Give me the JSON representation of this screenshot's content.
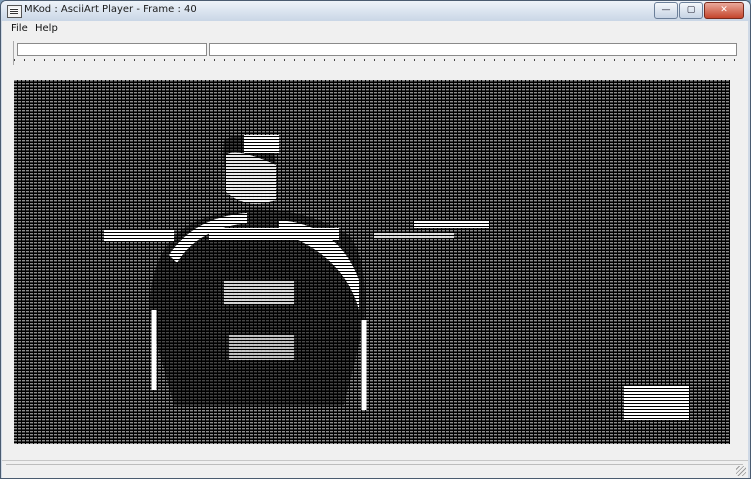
{
  "window": {
    "title": "MKod : AsciiArt Player - Frame : 40",
    "controls": [
      "minimize-icon",
      "maximize-icon",
      "close-icon"
    ]
  },
  "menu": {
    "items": [
      {
        "label": "File"
      },
      {
        "label": "Help"
      }
    ]
  },
  "toolbar": {
    "left_field_value": "",
    "right_field_value": ""
  },
  "timeline": {
    "position_fraction": 0.0
  },
  "display": {
    "background": "#000000",
    "foreground": "#ffffff",
    "content": "ascii-art video frame"
  },
  "status": {
    "text": ""
  }
}
